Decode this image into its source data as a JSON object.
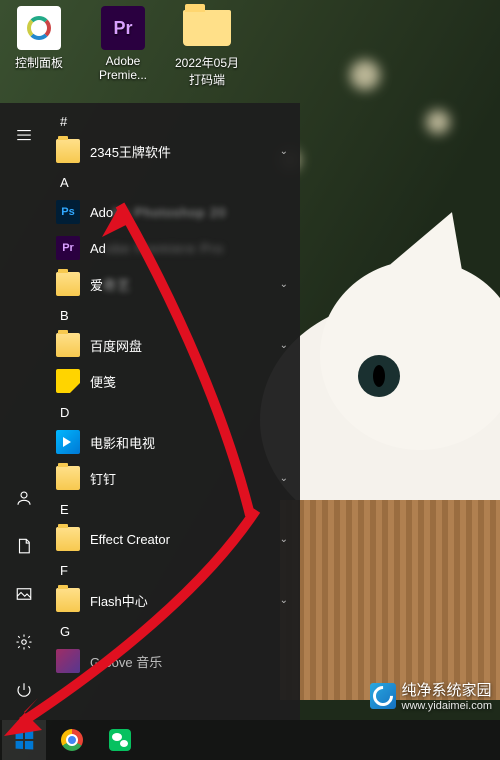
{
  "desktop": {
    "icons": [
      {
        "name": "control-panel",
        "label": "控制面板"
      },
      {
        "name": "adobe-premiere",
        "label": "Adobe Premie...",
        "badge": "Pr"
      },
      {
        "name": "folder-2022-05",
        "label": "2022年05月打码端"
      }
    ]
  },
  "start_menu": {
    "header": "#",
    "sections": [
      {
        "letter": "",
        "items": [
          {
            "name": "2345",
            "label": "2345王牌软件",
            "icon": "folder",
            "expandable": true
          }
        ]
      },
      {
        "letter": "A",
        "items": [
          {
            "name": "adobe-ps",
            "label_prefix": "Ado",
            "label_blur": "be Photoshop 20",
            "icon": "ps"
          },
          {
            "name": "adobe-pr",
            "label_prefix": "Ad",
            "label_blur": "obe Premiere Pro",
            "icon": "pr"
          },
          {
            "name": "ai-folder",
            "label_prefix": "爱",
            "label_blur": "奇艺",
            "icon": "folder",
            "expandable": true
          }
        ]
      },
      {
        "letter": "B",
        "items": [
          {
            "name": "baidu-netdisk",
            "label": "百度网盘",
            "icon": "folder",
            "expandable": true
          },
          {
            "name": "sticky-notes",
            "label": "便笺",
            "icon": "note"
          }
        ]
      },
      {
        "letter": "D",
        "items": [
          {
            "name": "movies-tv",
            "label": "电影和电视",
            "icon": "movie"
          },
          {
            "name": "dingding",
            "label": "钉钉",
            "icon": "folder",
            "expandable": true
          }
        ]
      },
      {
        "letter": "E",
        "items": [
          {
            "name": "effect-creator",
            "label": "Effect Creator",
            "icon": "folder",
            "expandable": true
          }
        ]
      },
      {
        "letter": "F",
        "items": [
          {
            "name": "flash-center",
            "label": "Flash中心",
            "icon": "folder",
            "expandable": true
          }
        ]
      },
      {
        "letter": "G",
        "items": [
          {
            "name": "groove-music",
            "label": "Groove 音乐",
            "icon": "groove"
          }
        ]
      }
    ],
    "rail": {
      "menu": "menu",
      "user": "user",
      "documents": "documents",
      "pictures": "pictures",
      "settings": "settings",
      "power": "power"
    }
  },
  "taskbar": {
    "items": [
      {
        "name": "start",
        "icon": "windows"
      },
      {
        "name": "chrome",
        "icon": "chrome"
      },
      {
        "name": "wechat",
        "icon": "wechat"
      }
    ]
  },
  "watermark": {
    "title": "纯净系统家园",
    "url": "www.yidaimei.com"
  }
}
